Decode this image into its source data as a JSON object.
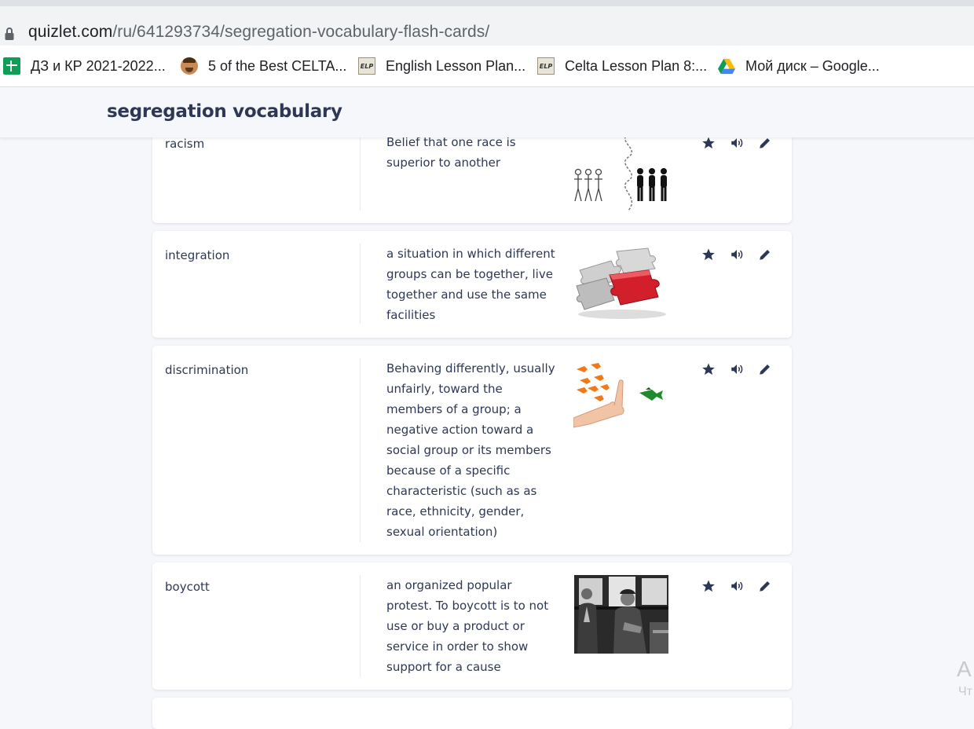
{
  "browser": {
    "url_host": "quizlet.com",
    "url_path": "/ru/641293734/segregation-vocabulary-flash-cards/",
    "bookmarks": [
      {
        "label": "ДЗ и КР 2021-2022...",
        "icon": "google-sheets-icon"
      },
      {
        "label": "5 of the Best CELTA...",
        "icon": "profile-face-icon"
      },
      {
        "label": "English Lesson Plan...",
        "icon": "elp-icon"
      },
      {
        "label": "Celta Lesson Plan 8:...",
        "icon": "elp-icon"
      },
      {
        "label": "Мой диск – Google...",
        "icon": "google-drive-icon"
      }
    ]
  },
  "header": {
    "title": "segregation vocabulary"
  },
  "cards": [
    {
      "term": "racism",
      "definition_lines": [
        "Belief that one race is",
        "superior to another"
      ],
      "image": "racism-illustration"
    },
    {
      "term": "integration",
      "definition_lines": [
        "a situation in which different",
        "groups can be together, live",
        "together and use the same",
        "facilities"
      ],
      "image": "puzzle-pieces-illustration"
    },
    {
      "term": "discrimination",
      "definition_lines": [
        "Behaving differently, usually",
        "unfairly, toward the",
        "members of a group; a",
        "negative action toward a",
        "social group or its members",
        "because of a specific",
        "characteristic (such as as",
        "race, ethnicity, gender,",
        "sexual orientation)"
      ],
      "image": "goldfish-hand-illustration"
    },
    {
      "term": "boycott",
      "definition_lines": [
        "an organized popular",
        "protest. To boycott is to not",
        "use or buy a product or",
        "service in order to show",
        "support for a cause"
      ],
      "image": "bus-photo"
    }
  ],
  "card_actions": [
    "star-icon",
    "audio-icon",
    "edit-icon"
  ],
  "colors": {
    "text": "#2e3856",
    "page_bg": "#f6f7fb",
    "card_bg": "#ffffff"
  },
  "corner": {
    "letter": "A",
    "sub": "Чт"
  }
}
